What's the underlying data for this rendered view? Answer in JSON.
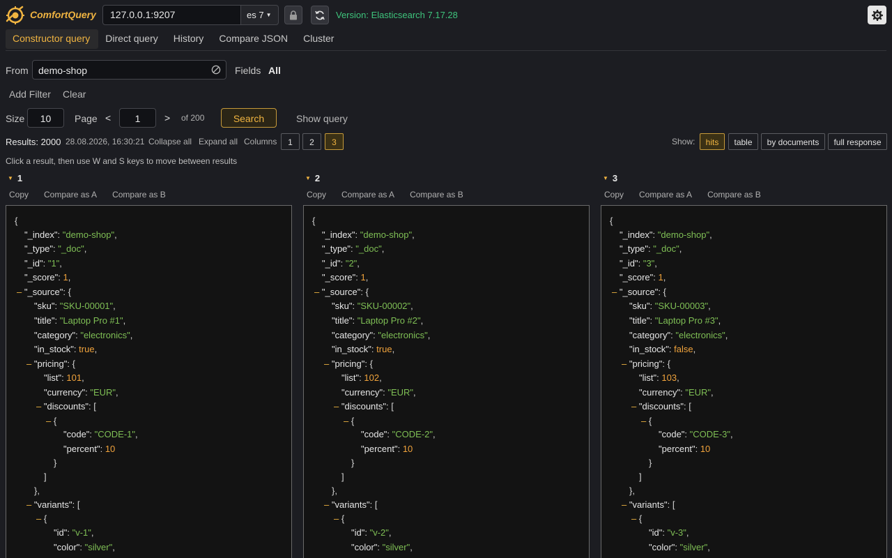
{
  "app": {
    "title": "ComfortQuery"
  },
  "connection": {
    "host": "127.0.0.1:9207",
    "es_version": "es 7",
    "version_label": "Version: Elasticsearch 7.17.28"
  },
  "tabs": [
    {
      "label": "Constructor query",
      "active": true
    },
    {
      "label": "Direct query",
      "active": false
    },
    {
      "label": "History",
      "active": false
    },
    {
      "label": "Compare JSON",
      "active": false
    },
    {
      "label": "Cluster",
      "active": false
    }
  ],
  "query": {
    "from_label": "From",
    "from_value": "demo-shop",
    "fields_label": "Fields",
    "fields_value": "All",
    "add_filter": "Add Filter",
    "clear": "Clear",
    "size_label": "Size",
    "size_value": "10",
    "page_label": "Page",
    "prev": "<",
    "page_value": "1",
    "next": ">",
    "of_pages": "of 200",
    "search": "Search",
    "show_query": "Show query"
  },
  "results_bar": {
    "results": "Results: 2000",
    "timestamp": "28.08.2026, 16:30:21",
    "collapse_all": "Collapse all",
    "expand_all": "Expand all",
    "columns_label": "Columns",
    "columns": [
      "1",
      "2",
      "3"
    ],
    "columns_active": "3",
    "show_label": "Show:",
    "show_options": [
      "hits",
      "table",
      "by documents",
      "full response"
    ],
    "show_active": "hits",
    "hint": "Click a result, then use W and S keys to move between results"
  },
  "result_actions": {
    "copy": "Copy",
    "compare_a": "Compare as A",
    "compare_b": "Compare as B"
  },
  "results": [
    {
      "num": "1",
      "index": "demo-shop",
      "type": "_doc",
      "id": "1",
      "score": "1",
      "sku": "SKU-00001",
      "title": "Laptop Pro #1",
      "category": "electronics",
      "in_stock": "true",
      "list": "101",
      "currency": "EUR",
      "code": "CODE-1",
      "percent": "10",
      "variant_id": "v-1",
      "color": "silver"
    },
    {
      "num": "2",
      "index": "demo-shop",
      "type": "_doc",
      "id": "2",
      "score": "1",
      "sku": "SKU-00002",
      "title": "Laptop Pro #2",
      "category": "electronics",
      "in_stock": "true",
      "list": "102",
      "currency": "EUR",
      "code": "CODE-2",
      "percent": "10",
      "variant_id": "v-2",
      "color": "silver"
    },
    {
      "num": "3",
      "index": "demo-shop",
      "type": "_doc",
      "id": "3",
      "score": "1",
      "sku": "SKU-00003",
      "title": "Laptop Pro #3",
      "category": "electronics",
      "in_stock": "false",
      "list": "103",
      "currency": "EUR",
      "code": "CODE-3",
      "percent": "10",
      "variant_id": "v-3",
      "color": "silver"
    }
  ],
  "colors": {
    "accent": "#f0b441",
    "version_green": "#3ec47c",
    "json_string": "#7fbf55",
    "json_number": "#f0a33c"
  }
}
